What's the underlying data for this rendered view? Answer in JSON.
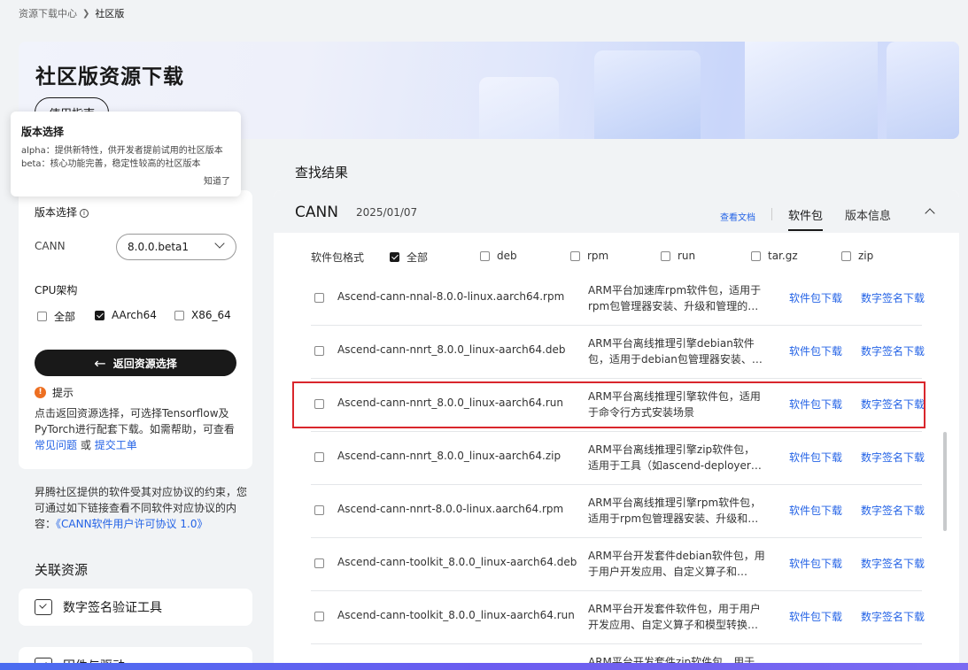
{
  "breadcrumb": {
    "root": "资源下载中心",
    "current": "社区版"
  },
  "banner": {
    "title": "社区版资源下载",
    "guide_button": "使用指南"
  },
  "tooltip": {
    "title": "版本选择",
    "line1": "alpha：提供新特性，供开发者提前试用的社区版本",
    "line2": "beta：核心功能完善，稳定性较高的社区版本",
    "ok": "知道了"
  },
  "left": {
    "version_label": "版本选择",
    "product": "CANN",
    "version_value": "8.0.0.beta1",
    "cpu_label": "CPU架构",
    "cpu_options": [
      {
        "label": "全部",
        "checked": false
      },
      {
        "label": "AArch64",
        "checked": true
      },
      {
        "label": "X86_64",
        "checked": false
      }
    ],
    "back_button": "返回资源选择",
    "tip_title": "提示",
    "tip_text": "点击返回资源选择，可选择Tensorflow及PyTorch进行配套下载。如需帮助，可查看",
    "tip_link1": "常见问题",
    "tip_or": "或",
    "tip_link2": "提交工单"
  },
  "license": {
    "text": "昇腾社区提供的软件受其对应协议的约束，您可通过如下链接查看不同软件对应协议的内容：",
    "link": "《CANN软件用户许可协议 1.0》"
  },
  "related": {
    "title": "关联资源",
    "items": [
      "数字签名验证工具",
      "固件与驱动"
    ]
  },
  "results": {
    "title": "查找结果",
    "product": "CANN",
    "date": "2025/01/07",
    "doc_link": "查看文档",
    "tab_packages": "软件包",
    "tab_version": "版本信息",
    "format_label": "软件包格式",
    "formats": [
      {
        "label": "全部",
        "checked": true
      },
      {
        "label": "deb",
        "checked": false
      },
      {
        "label": "rpm",
        "checked": false
      },
      {
        "label": "run",
        "checked": false
      },
      {
        "label": "tar.gz",
        "checked": false
      },
      {
        "label": "zip",
        "checked": false
      }
    ],
    "download_label": "软件包下载",
    "signature_label": "数字签名下载",
    "rows": [
      {
        "name": "Ascend-cann-nnal-8.0.0-linux.aarch64.rpm",
        "desc": "ARM平台加速库rpm软件包，适用于rpm包管理器安装、升级和管理的…"
      },
      {
        "name": "Ascend-cann-nnrt_8.0.0_linux-aarch64.deb",
        "desc": "ARM平台离线推理引擎debian软件包，适用于debian包管理器安装、…"
      },
      {
        "name": "Ascend-cann-nnrt_8.0.0_linux-aarch64.run",
        "desc": "ARM平台离线推理引擎软件包，适用于命令行方式安装场景"
      },
      {
        "name": "Ascend-cann-nnrt_8.0.0_linux-aarch64.zip",
        "desc": "ARM平台离线推理引擎zip软件包，适用于工具（如ascend-deployer…"
      },
      {
        "name": "Ascend-cann-nnrt-8.0.0-linux.aarch64.rpm",
        "desc": "ARM平台离线推理引擎rpm软件包，适用于rpm包管理器安装、升级和…"
      },
      {
        "name": "Ascend-cann-toolkit_8.0.0_linux-aarch64.deb",
        "desc": "ARM平台开发套件debian软件包，用于用户开发应用、自定义算子和…"
      },
      {
        "name": "Ascend-cann-toolkit_8.0.0_linux-aarch64.run",
        "desc": "ARM平台开发套件软件包，用于用户开发应用、自定义算子和模型转换…"
      },
      {
        "name": "",
        "desc": "ARM平台开发套件zip软件包，用于"
      }
    ]
  }
}
